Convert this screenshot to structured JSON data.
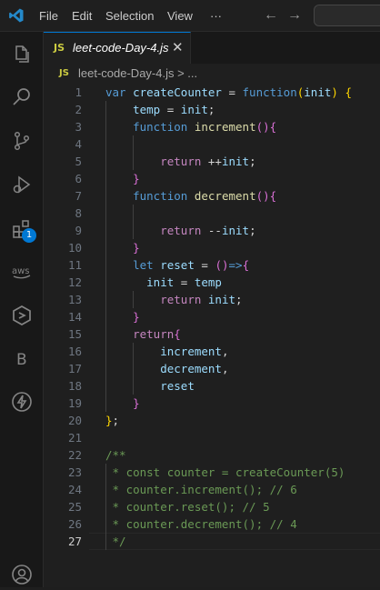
{
  "menu": [
    "File",
    "Edit",
    "Selection",
    "View",
    "···"
  ],
  "tab": {
    "icon": "JS",
    "label": "leet-code-Day-4.js",
    "close": "✕"
  },
  "breadcrumb": {
    "icon": "JS",
    "text": "leet-code-Day-4.js > ..."
  },
  "activity": {
    "extensions_badge": "1",
    "b_label": "B"
  },
  "colors": {
    "accent": "#0078d4",
    "keyword": "#569cd6",
    "control": "#c586c0",
    "variable": "#9cdcfe",
    "function": "#dcdcaa",
    "comment": "#6a9955"
  },
  "editor": {
    "current_line": 27,
    "lines": [
      {
        "n": "1",
        "tokens": [
          [
            "k",
            "var"
          ],
          [
            "p",
            " "
          ],
          [
            "v",
            "createCounter"
          ],
          [
            "p",
            " = "
          ],
          [
            "k",
            "function"
          ],
          [
            "b1",
            "("
          ],
          [
            "v",
            "init"
          ],
          [
            "b1",
            ")"
          ],
          [
            "p",
            " "
          ],
          [
            "b1",
            "{"
          ]
        ]
      },
      {
        "n": "2",
        "tokens": [
          [
            "p",
            "    "
          ],
          [
            "v",
            "temp"
          ],
          [
            "p",
            " = "
          ],
          [
            "v",
            "init"
          ],
          [
            "p",
            ";"
          ]
        ]
      },
      {
        "n": "3",
        "tokens": [
          [
            "p",
            "    "
          ],
          [
            "k",
            "function"
          ],
          [
            "p",
            " "
          ],
          [
            "f",
            "increment"
          ],
          [
            "b2",
            "()"
          ],
          [
            "b2",
            "{"
          ]
        ]
      },
      {
        "n": "4",
        "tokens": []
      },
      {
        "n": "5",
        "tokens": [
          [
            "p",
            "        "
          ],
          [
            "kc",
            "return"
          ],
          [
            "p",
            " ++"
          ],
          [
            "v",
            "init"
          ],
          [
            "p",
            ";"
          ]
        ]
      },
      {
        "n": "6",
        "tokens": [
          [
            "p",
            "    "
          ],
          [
            "b2",
            "}"
          ]
        ]
      },
      {
        "n": "7",
        "tokens": [
          [
            "p",
            "    "
          ],
          [
            "k",
            "function"
          ],
          [
            "p",
            " "
          ],
          [
            "f",
            "decrement"
          ],
          [
            "b2",
            "()"
          ],
          [
            "b2",
            "{"
          ]
        ]
      },
      {
        "n": "8",
        "tokens": []
      },
      {
        "n": "9",
        "tokens": [
          [
            "p",
            "        "
          ],
          [
            "kc",
            "return"
          ],
          [
            "p",
            " --"
          ],
          [
            "v",
            "init"
          ],
          [
            "p",
            ";"
          ]
        ]
      },
      {
        "n": "10",
        "tokens": [
          [
            "p",
            "    "
          ],
          [
            "b2",
            "}"
          ]
        ]
      },
      {
        "n": "11",
        "tokens": [
          [
            "p",
            "    "
          ],
          [
            "k",
            "let"
          ],
          [
            "p",
            " "
          ],
          [
            "v",
            "reset"
          ],
          [
            "p",
            " = "
          ],
          [
            "b2",
            "()"
          ],
          [
            "k",
            "=>"
          ],
          [
            "b2",
            "{"
          ]
        ]
      },
      {
        "n": "12",
        "tokens": [
          [
            "p",
            "      "
          ],
          [
            "v",
            "init"
          ],
          [
            "p",
            " = "
          ],
          [
            "v",
            "temp"
          ]
        ]
      },
      {
        "n": "13",
        "tokens": [
          [
            "p",
            "        "
          ],
          [
            "kc",
            "return"
          ],
          [
            "p",
            " "
          ],
          [
            "v",
            "init"
          ],
          [
            "p",
            ";"
          ]
        ]
      },
      {
        "n": "14",
        "tokens": [
          [
            "p",
            "    "
          ],
          [
            "b2",
            "}"
          ]
        ]
      },
      {
        "n": "15",
        "tokens": [
          [
            "p",
            "    "
          ],
          [
            "kc",
            "return"
          ],
          [
            "b2",
            "{"
          ]
        ]
      },
      {
        "n": "16",
        "tokens": [
          [
            "p",
            "        "
          ],
          [
            "v",
            "increment"
          ],
          [
            "p",
            ","
          ]
        ]
      },
      {
        "n": "17",
        "tokens": [
          [
            "p",
            "        "
          ],
          [
            "v",
            "decrement"
          ],
          [
            "p",
            ","
          ]
        ]
      },
      {
        "n": "18",
        "tokens": [
          [
            "p",
            "        "
          ],
          [
            "v",
            "reset"
          ]
        ]
      },
      {
        "n": "19",
        "tokens": [
          [
            "p",
            "    "
          ],
          [
            "b2",
            "}"
          ]
        ]
      },
      {
        "n": "20",
        "tokens": [
          [
            "b1",
            "}"
          ],
          [
            "p",
            ";"
          ]
        ]
      },
      {
        "n": "21",
        "tokens": []
      },
      {
        "n": "22",
        "tokens": [
          [
            "c",
            "/**"
          ]
        ]
      },
      {
        "n": "23",
        "tokens": [
          [
            "c",
            " * const counter = createCounter(5)"
          ]
        ]
      },
      {
        "n": "24",
        "tokens": [
          [
            "c",
            " * counter.increment(); // 6"
          ]
        ]
      },
      {
        "n": "25",
        "tokens": [
          [
            "c",
            " * counter.reset(); // 5"
          ]
        ]
      },
      {
        "n": "26",
        "tokens": [
          [
            "c",
            " * counter.decrement(); // 4"
          ]
        ]
      },
      {
        "n": "27",
        "tokens": [
          [
            "c",
            " */"
          ]
        ]
      }
    ]
  }
}
